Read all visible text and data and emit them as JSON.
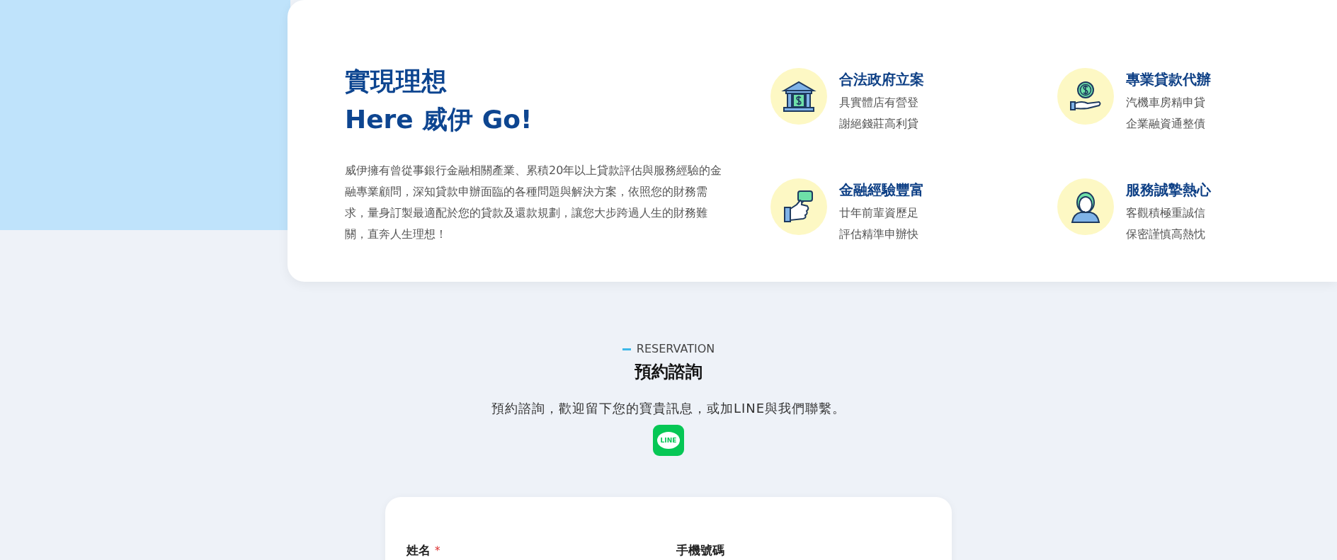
{
  "intro": {
    "title_line1": "實現理想",
    "title_line2": "Here 威伊 Go!",
    "description": "威伊擁有曾從事銀行金融相關產業、累積20年以上貸款評估與服務經驗的金融專業顧問，深知貸款申辦面臨的各種問題與解決方案，依照您的財務需求，量身訂製最適配於您的貸款及還款規劃，讓您大步跨過人生的財務難關，直奔人生理想！"
  },
  "features": [
    {
      "kind": "bank",
      "title": "合法政府立案",
      "lines": [
        "具實體店有營登",
        "謝絕錢莊高利貸"
      ]
    },
    {
      "kind": "coin-hand",
      "title": "專業貸款代辦",
      "lines": [
        "汽機車房精申貸",
        "企業融資通整債"
      ]
    },
    {
      "kind": "thumbs-up",
      "title": "金融經驗豐富",
      "lines": [
        "廿年前輩資歷足",
        "評估精準申辦快"
      ]
    },
    {
      "kind": "agent",
      "title": "服務誠摯熱心",
      "lines": [
        "客觀積極重誠信",
        "保密謹慎高熱忱"
      ]
    }
  ],
  "reservation": {
    "eyebrow": "RESERVATION",
    "title": "預約諮詢",
    "subtitle": "預約諮詢，歡迎留下您的寶貴訊息，或加LINE與我們聯繫。",
    "line_logo_text": "LINE"
  },
  "form": {
    "fields": [
      {
        "label": "姓名",
        "required_mark": "*"
      },
      {
        "label": "手機號碼"
      }
    ]
  }
}
